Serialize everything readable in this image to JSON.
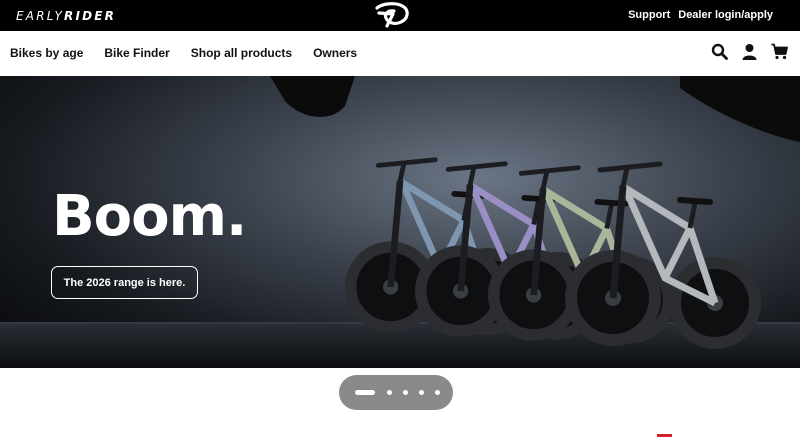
{
  "brand": {
    "part1": "EARLY",
    "part2": "RIDER"
  },
  "logo": {
    "icon": "early-rider-e-logo"
  },
  "top_links": {
    "support": "Support",
    "dealer": "Dealer login/apply"
  },
  "nav": {
    "items": [
      "Bikes by age",
      "Bike Finder",
      "Shop all products",
      "Owners"
    ],
    "icons": [
      "search-icon",
      "account-icon",
      "cart-icon"
    ]
  },
  "hero": {
    "title": "Boom.",
    "cta": "The 2026 range is here.",
    "bike_frame_colors": [
      "#7f96b0",
      "#9a8fc4",
      "#a9b69a",
      "#b4b8bd"
    ]
  },
  "carousel": {
    "slide_count": 5,
    "active_index": 0
  },
  "colors": {
    "topbar": "#000000",
    "accent": "#d2202f",
    "pager": "#8a8a8a"
  }
}
